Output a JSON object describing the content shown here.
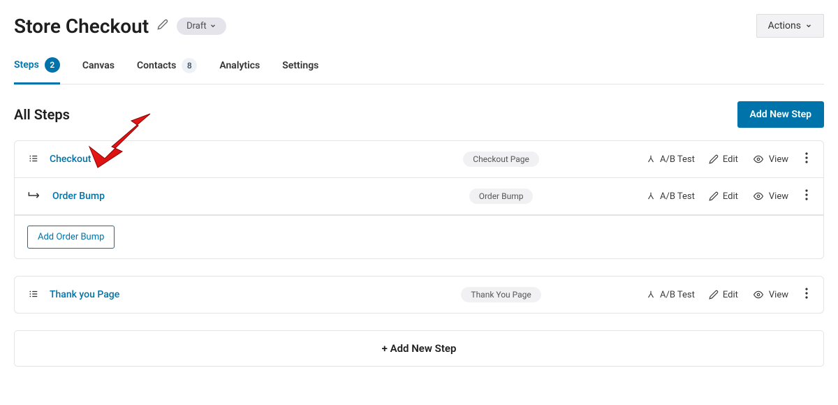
{
  "header": {
    "title": "Store Checkout",
    "status_label": "Draft",
    "actions_label": "Actions"
  },
  "tabs": [
    {
      "key": "steps",
      "label": "Steps",
      "badge": "2",
      "active": true,
      "badgeStyle": "circle"
    },
    {
      "key": "canvas",
      "label": "Canvas"
    },
    {
      "key": "contacts",
      "label": "Contacts",
      "badge": "8",
      "badgeStyle": "pill"
    },
    {
      "key": "analytics",
      "label": "Analytics"
    },
    {
      "key": "settings",
      "label": "Settings"
    }
  ],
  "section": {
    "title": "All Steps",
    "add_button": "Add New Step"
  },
  "row_actions": {
    "ab_test": "A/B Test",
    "edit": "Edit",
    "view": "View"
  },
  "groups": [
    {
      "rows": [
        {
          "icon": "list",
          "title": "Checkout",
          "type_label": "Checkout Page"
        },
        {
          "icon": "branch",
          "title": "Order Bump",
          "type_label": "Order Bump"
        }
      ],
      "footer_button": "Add Order Bump"
    },
    {
      "rows": [
        {
          "icon": "list",
          "title": "Thank you Page",
          "type_label": "Thank You Page"
        }
      ]
    }
  ],
  "add_bar": {
    "label": "+ Add New Step"
  }
}
